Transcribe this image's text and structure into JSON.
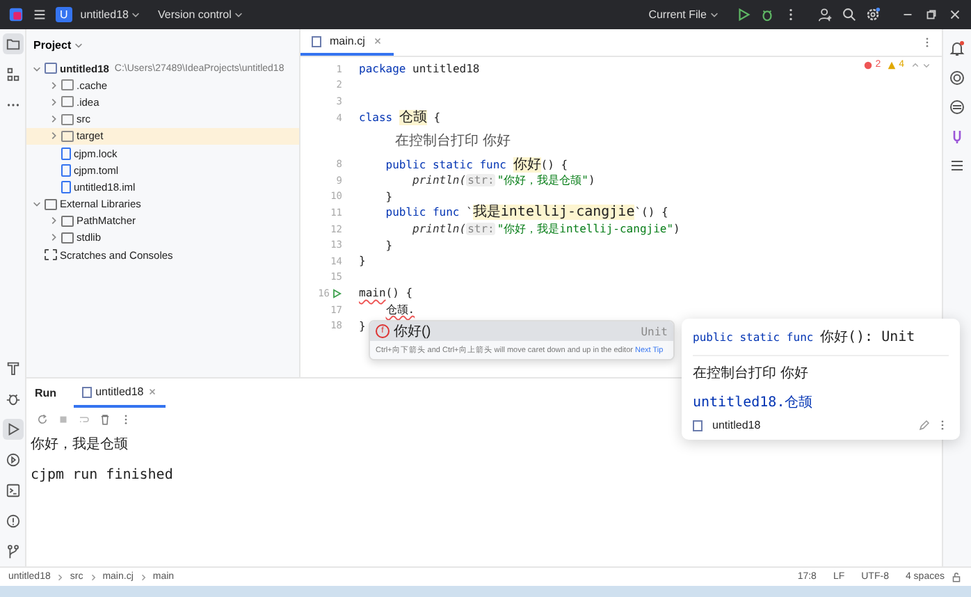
{
  "title_bar": {
    "project_badge": "U",
    "project": "untitled18",
    "vcs": "Version control",
    "run_config": "Current File"
  },
  "left_strip": {
    "top": [
      {
        "kind": "folder",
        "selected": true
      },
      {
        "kind": "structure",
        "selected": false
      },
      {
        "kind": "more",
        "selected": false
      }
    ],
    "bottom": [
      {
        "kind": "build",
        "selected": false
      },
      {
        "kind": "debug",
        "selected": false
      },
      {
        "kind": "run",
        "selected": true
      },
      {
        "kind": "services",
        "selected": false
      },
      {
        "kind": "terminal",
        "selected": false
      },
      {
        "kind": "problems",
        "selected": false
      },
      {
        "kind": "git",
        "selected": false
      }
    ]
  },
  "project_panel": {
    "title": "Project",
    "tree": [
      {
        "kind": "module",
        "label": "untitled18",
        "path": "C:\\Users\\27489\\IdeaProjects\\untitled18",
        "expanded": true,
        "selected": false,
        "children": [
          {
            "kind": "folder",
            "label": ".cache",
            "expanded": false,
            "selected": false
          },
          {
            "kind": "folder",
            "label": ".idea",
            "expanded": false,
            "selected": false
          },
          {
            "kind": "folder",
            "label": "src",
            "expanded": false,
            "selected": false
          },
          {
            "kind": "folder",
            "label": "target",
            "expanded": false,
            "selected": true
          },
          {
            "kind": "file",
            "label": "cjpm.lock",
            "selected": false
          },
          {
            "kind": "file",
            "label": "cjpm.toml",
            "selected": false
          },
          {
            "kind": "file",
            "label": "untitled18.iml",
            "selected": false
          }
        ]
      },
      {
        "kind": "library",
        "label": "External Libraries",
        "expanded": true,
        "selected": false,
        "children": [
          {
            "kind": "library",
            "label": "PathMatcher",
            "expanded": false,
            "selected": false
          },
          {
            "kind": "library",
            "label": "stdlib",
            "expanded": false,
            "selected": false
          }
        ]
      },
      {
        "kind": "scratch",
        "label": "Scratches and Consoles",
        "selected": false
      }
    ]
  },
  "editor": {
    "tabs": [
      {
        "label": "main.cj",
        "selected": true
      }
    ],
    "errors": "2",
    "warnings": "4",
    "lines": [
      {
        "kind": "code",
        "number": "1",
        "segments": [
          {
            "kind": "kw",
            "text": "package"
          },
          {
            "kind": "plain",
            "text": " untitled18"
          }
        ]
      },
      {
        "kind": "code",
        "number": "2"
      },
      {
        "kind": "code",
        "number": "3"
      },
      {
        "kind": "code",
        "number": "4",
        "segments": [
          {
            "kind": "kw",
            "text": "class "
          },
          {
            "kind": "hl",
            "text": "仓颉"
          },
          {
            "kind": "plain",
            "text": " {"
          }
        ]
      },
      {
        "kind": "doc",
        "text": "在控制台打印 你好"
      },
      {
        "kind": "code",
        "number": "8",
        "segments": [
          {
            "kind": "kw",
            "text": "    public static func "
          },
          {
            "kind": "hl",
            "text": "你好"
          },
          {
            "kind": "plain",
            "text": "() {"
          }
        ]
      },
      {
        "kind": "code",
        "number": "9",
        "segments": [
          {
            "kind": "fn",
            "text": "        println("
          },
          {
            "kind": "hint",
            "text": "str:"
          },
          {
            "kind": "str",
            "text": "\"你好，我是仓颉\""
          },
          {
            "kind": "plain",
            "text": ")"
          }
        ]
      },
      {
        "kind": "code",
        "number": "10",
        "segments": [
          {
            "kind": "plain",
            "text": "    }"
          }
        ]
      },
      {
        "kind": "code",
        "number": "11",
        "segments": [
          {
            "kind": "kw",
            "text": "    public func "
          },
          {
            "kind": "plain",
            "text": "`"
          },
          {
            "kind": "hl",
            "text": "我是intellij-cangjie"
          },
          {
            "kind": "plain",
            "text": "`() {"
          }
        ]
      },
      {
        "kind": "code",
        "number": "12",
        "segments": [
          {
            "kind": "fn",
            "text": "        println("
          },
          {
            "kind": "hint",
            "text": "str:"
          },
          {
            "kind": "str",
            "text": "\"你好，我是intellij-cangjie\""
          },
          {
            "kind": "plain",
            "text": ")"
          }
        ]
      },
      {
        "kind": "code",
        "number": "13",
        "segments": [
          {
            "kind": "plain",
            "text": "    }"
          }
        ]
      },
      {
        "kind": "code",
        "number": "14",
        "segments": [
          {
            "kind": "plain",
            "text": "}"
          }
        ]
      },
      {
        "kind": "code",
        "number": "15"
      },
      {
        "kind": "run",
        "number": "16",
        "segments": [
          {
            "kind": "err",
            "text": "main"
          },
          {
            "kind": "plain",
            "text": "() {"
          }
        ]
      },
      {
        "kind": "code",
        "number": "17",
        "segments": [
          {
            "kind": "err",
            "text": "    仓颉."
          }
        ]
      },
      {
        "kind": "code",
        "number": "18",
        "segments": [
          {
            "kind": "plain",
            "text": "}"
          }
        ]
      }
    ]
  },
  "completion": {
    "items": [
      {
        "icon": "f",
        "name": "你好()",
        "type": "Unit",
        "selected": true
      }
    ],
    "hint": "Ctrl+向下箭头 and Ctrl+向上箭头 will move caret down and up in the editor",
    "hint_link": "Next Tip"
  },
  "doc_popup": {
    "signature_keywords": "public static func ",
    "signature_rest": "你好(): Unit",
    "description": "在控制台打印 你好",
    "location": "untitled18.仓颉",
    "module": "untitled18"
  },
  "run_panel": {
    "title": "Run",
    "tabs": [
      {
        "label": "untitled18",
        "selected": true
      }
    ],
    "output": [
      "你好，我是仓颉",
      "cjpm run finished"
    ]
  },
  "status_bar": {
    "breadcrumbs": [
      "untitled18",
      "src",
      "main.cj",
      "main"
    ],
    "items": [
      "17:8",
      "LF",
      "UTF-8",
      "4 spaces"
    ]
  }
}
